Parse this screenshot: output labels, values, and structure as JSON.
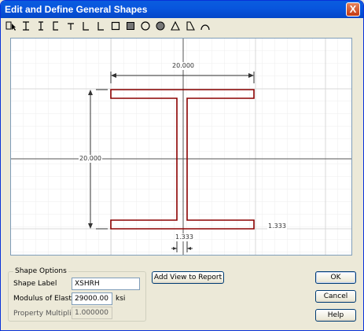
{
  "window": {
    "title": "Edit and Define General Shapes",
    "close_glyph": "X"
  },
  "toolbar": {
    "tools": [
      "select-icon",
      "i-beam-icon",
      "i-shape-icon",
      "channel-icon",
      "tee-icon",
      "angle-icon",
      "double-angle-icon",
      "box-icon",
      "solid-rect-icon",
      "pipe-icon",
      "solid-circle-icon",
      "triangle-icon",
      "trapezoid-icon",
      "arc-icon"
    ]
  },
  "drawing": {
    "top_dim": "20.000",
    "left_dim": "20.000",
    "flange_dim": "1.333",
    "web_dim": "1.333",
    "outline_color": "#8b0000"
  },
  "shape_options": {
    "legend": "Shape Options",
    "label_caption": "Shape Label",
    "label_value": "XSHRH",
    "modulus_caption": "Modulus of Elasticity",
    "modulus_value": "29000.00",
    "modulus_unit": "ksi",
    "multiplier_caption": "Property Multiplier",
    "multiplier_value": "1.000000"
  },
  "buttons": {
    "add_view": "Add View to Report",
    "ok": "OK",
    "cancel": "Cancel",
    "help": "Help"
  }
}
